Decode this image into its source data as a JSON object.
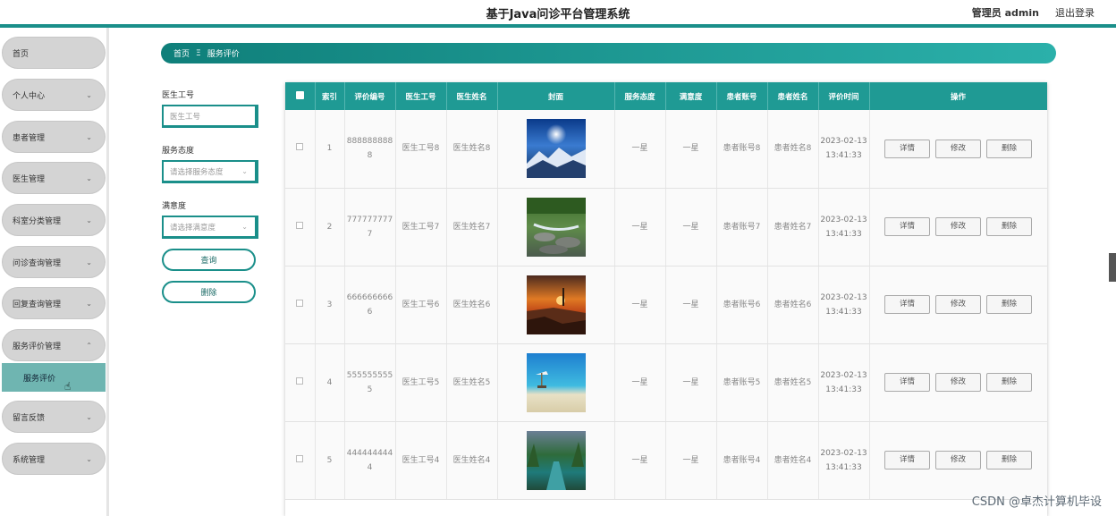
{
  "header": {
    "title": "基于Java问诊平台管理系统",
    "user": "管理员 admin",
    "logout": "退出登录"
  },
  "sidebar": {
    "items": [
      {
        "label": "首页",
        "chevron": ""
      },
      {
        "label": "个人中心",
        "chevron": "⌄"
      },
      {
        "label": "患者管理",
        "chevron": "⌄"
      },
      {
        "label": "医生管理",
        "chevron": "⌄"
      },
      {
        "label": "科室分类管理",
        "chevron": "⌄"
      },
      {
        "label": "问诊查询管理",
        "chevron": "⌄"
      },
      {
        "label": "回复查询管理",
        "chevron": "⌄"
      },
      {
        "label": "服务评价管理",
        "chevron": "⌃"
      },
      {
        "label": "留言反馈",
        "chevron": "⌄"
      },
      {
        "label": "系统管理",
        "chevron": "⌄"
      }
    ],
    "subitem": "服务评价",
    "cursor": "☝"
  },
  "breadcrumb": {
    "home": "首页",
    "sep": "Ξ",
    "current": "服务评价"
  },
  "search": {
    "doctor_id_label": "医生工号",
    "doctor_id_placeholder": "医生工号",
    "service_label": "服务态度",
    "service_placeholder": "请选择服务态度",
    "satisfaction_label": "满意度",
    "satisfaction_placeholder": "请选择满意度",
    "dropdown_icon": "⌄",
    "query_btn": "查询",
    "delete_btn": "删除"
  },
  "table": {
    "headers": [
      "",
      "索引",
      "评价编号",
      "医生工号",
      "医生姓名",
      "封面",
      "服务态度",
      "满意度",
      "患者账号",
      "患者姓名",
      "评价时间",
      "操作"
    ],
    "actions": {
      "detail": "详情",
      "edit": "修改",
      "delete": "删除"
    },
    "rows": [
      {
        "idx": "1",
        "code": "8888888888",
        "doc_id": "医生工号8",
        "doc_name": "医生姓名8",
        "service": "一星",
        "satisfaction": "一星",
        "pat_id": "患者账号8",
        "pat_name": "患者姓名8",
        "time": "2023-02-13 13:41:33",
        "img": "mountain"
      },
      {
        "idx": "2",
        "code": "7777777777",
        "doc_id": "医生工号7",
        "doc_name": "医生姓名7",
        "service": "一星",
        "satisfaction": "一星",
        "pat_id": "患者账号7",
        "pat_name": "患者姓名7",
        "time": "2023-02-13 13:41:33",
        "img": "stream"
      },
      {
        "idx": "3",
        "code": "6666666666",
        "doc_id": "医生工号6",
        "doc_name": "医生姓名6",
        "service": "一星",
        "satisfaction": "一星",
        "pat_id": "患者账号6",
        "pat_name": "患者姓名6",
        "time": "2023-02-13 13:41:33",
        "img": "sunset"
      },
      {
        "idx": "4",
        "code": "5555555555",
        "doc_id": "医生工号5",
        "doc_name": "医生姓名5",
        "service": "一星",
        "satisfaction": "一星",
        "pat_id": "患者账号5",
        "pat_name": "患者姓名5",
        "time": "2023-02-13 13:41:33",
        "img": "beach"
      },
      {
        "idx": "5",
        "code": "4444444444",
        "doc_id": "医生工号4",
        "doc_name": "医生姓名4",
        "service": "一星",
        "satisfaction": "一星",
        "pat_id": "患者账号4",
        "pat_name": "患者姓名4",
        "time": "2023-02-13 13:41:33",
        "img": "river"
      }
    ]
  },
  "watermark": "CSDN @卓杰计算机毕设",
  "colors": {
    "accent": "#1a8f8a",
    "header_bg": "#1f9a94",
    "submenu": "#6fb5b1"
  }
}
